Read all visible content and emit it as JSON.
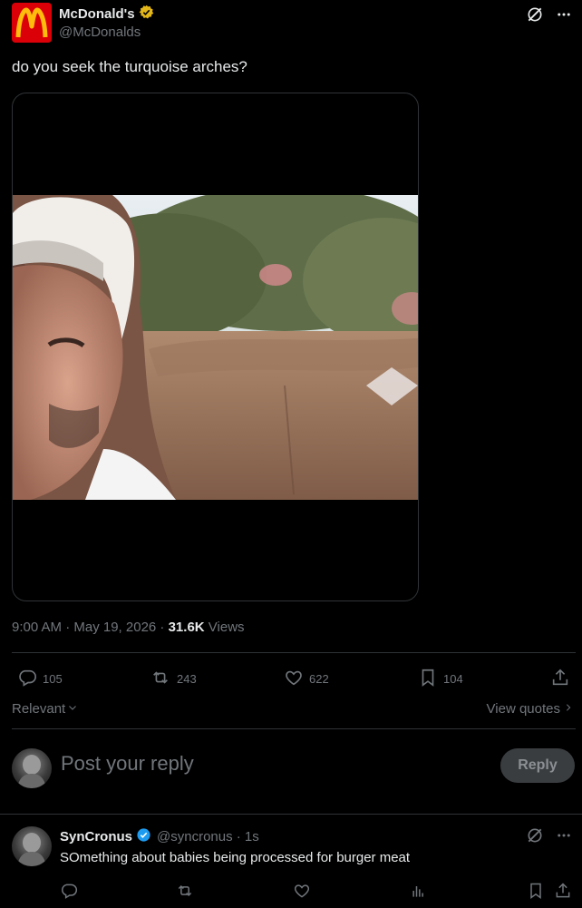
{
  "tweet": {
    "author_name": "McDonald's",
    "author_handle": "@McDonalds",
    "text": "do you seek the turquoise arches?",
    "timestamp": "9:00 AM · May 19, 2026 · ",
    "views_count": "31.6K",
    "views_label": " Views"
  },
  "actions": {
    "replies": "105",
    "reposts": "243",
    "likes": "622",
    "bookmarks": "104"
  },
  "sort": {
    "label": "Relevant",
    "view_quotes": "View quotes"
  },
  "composer": {
    "placeholder": "Post your reply",
    "reply_button": "Reply"
  },
  "reply": {
    "author_name": "SynCronus",
    "author_handle": "@syncronus · 1s",
    "text": "SOmething about babies being processed for burger meat"
  },
  "colors": {
    "background": "#000000",
    "text": "#e7e9ea",
    "muted": "#71767b",
    "verified_gold": "#e2b719",
    "verified_blue": "#1d9bf0",
    "brand_red": "#db0007",
    "brand_yellow": "#ffbc0d"
  },
  "icons": [
    "mcdonalds-logo",
    "gold-verified-badge",
    "grok-icon",
    "more-icon",
    "reply-icon",
    "repost-icon",
    "like-icon",
    "bookmark-icon",
    "share-icon",
    "views-icon",
    "chevron-down-icon",
    "chevron-right-icon",
    "blue-verified-badge"
  ]
}
